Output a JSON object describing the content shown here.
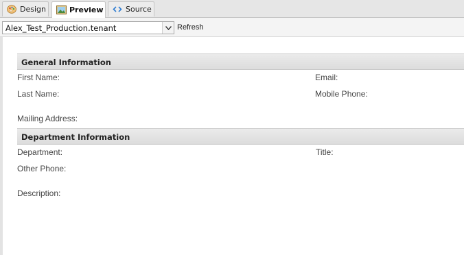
{
  "tabs": [
    {
      "label": "Design",
      "icon": "design-icon",
      "active": false
    },
    {
      "label": "Preview",
      "icon": "preview-icon",
      "active": true
    },
    {
      "label": "Source",
      "icon": "source-icon",
      "active": false
    }
  ],
  "toolbar": {
    "tenant_select_value": "Alex_Test_Production.tenant",
    "refresh_label": "Refresh"
  },
  "form": {
    "general": {
      "header": "General Information",
      "first_name_label": "First Name:",
      "email_label": "Email:",
      "last_name_label": "Last Name:",
      "mobile_phone_label": "Mobile Phone:",
      "mailing_address_label": "Mailing Address:"
    },
    "department": {
      "header": "Department Information",
      "department_label": "Department:",
      "title_label": "Title:",
      "other_phone_label": "Other Phone:",
      "description_label": "Description:"
    }
  },
  "colors": {
    "tab_bar": "#e6e6e6",
    "section_header": "#dcdcdc",
    "preview_icon": "#4a8a3a"
  }
}
